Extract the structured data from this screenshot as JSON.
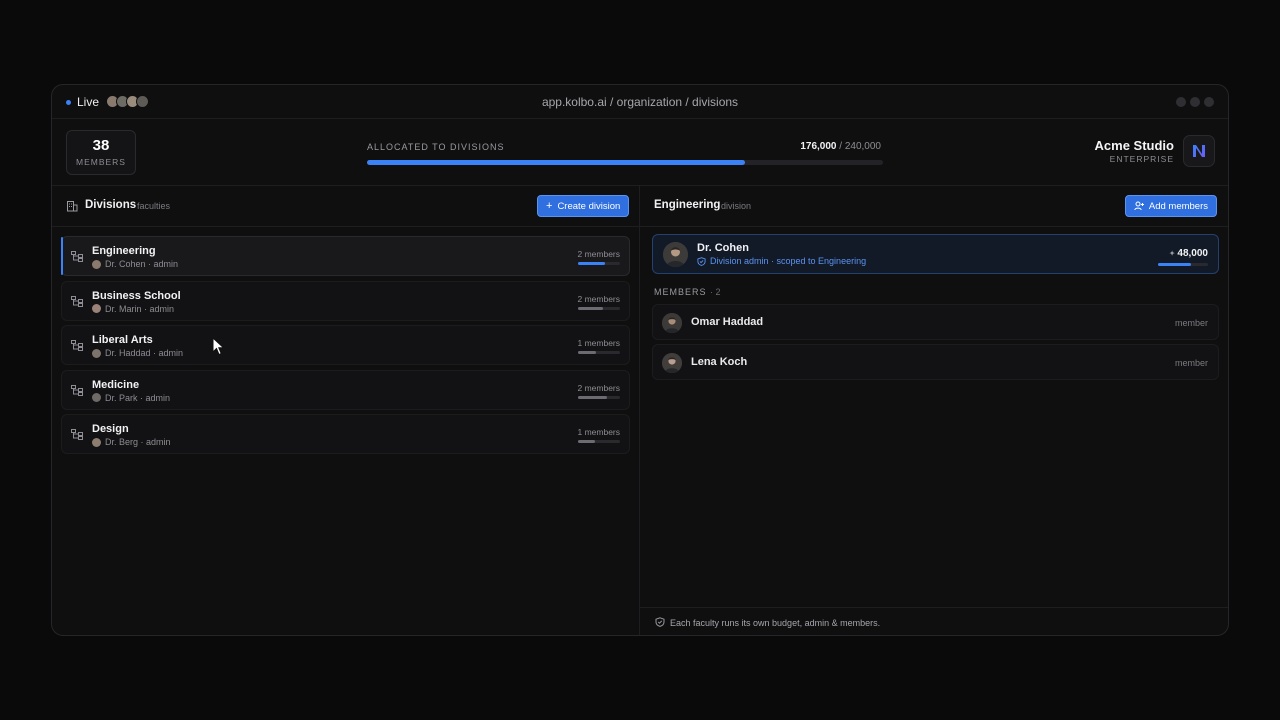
{
  "titlebar": {
    "live_label": "Live",
    "url": "app.kolbo.ai / organization / divisions"
  },
  "stats": {
    "members_count": "38",
    "members_label": "MEMBERS",
    "allocated_label": "ALLOCATED TO DIVISIONS",
    "allocated_value": "176,000",
    "allocated_total": "/ 240,000",
    "allocated_fraction": 0.733
  },
  "org": {
    "name": "Acme Studio",
    "plan": "ENTERPRISE"
  },
  "divisions_panel": {
    "title": "Divisions",
    "subtitle": "faculties",
    "create_button": "Create division",
    "items": [
      {
        "name": "Engineering",
        "admin": "Dr. Cohen · admin",
        "count": "2 members",
        "fill": 0.65,
        "active": true
      },
      {
        "name": "Business School",
        "admin": "Dr. Marin · admin",
        "count": "2 members",
        "fill": 0.6,
        "active": false
      },
      {
        "name": "Liberal Arts",
        "admin": "Dr. Haddad · admin",
        "count": "1 members",
        "fill": 0.42,
        "active": false
      },
      {
        "name": "Medicine",
        "admin": "Dr. Park · admin",
        "count": "2 members",
        "fill": 0.68,
        "active": false
      },
      {
        "name": "Design",
        "admin": "Dr. Berg · admin",
        "count": "1 members",
        "fill": 0.4,
        "active": false
      }
    ]
  },
  "detail_panel": {
    "title": "Engineering",
    "subtitle": "division",
    "add_button": "Add members",
    "admin": {
      "name": "Dr. Cohen",
      "role": "Division admin · scoped to Engineering",
      "budget": "48,000",
      "budget_fraction": 0.65
    },
    "members_label": "MEMBERS",
    "members_count": "· 2",
    "members": [
      {
        "name": "Omar Haddad",
        "role": "member"
      },
      {
        "name": "Lena Koch",
        "role": "member"
      }
    ],
    "footer_note": "Each faculty runs its own budget, admin & members."
  },
  "colors": {
    "accent": "#3b82f6",
    "background": "#0a0a0b",
    "panel": "#0f0f10"
  }
}
